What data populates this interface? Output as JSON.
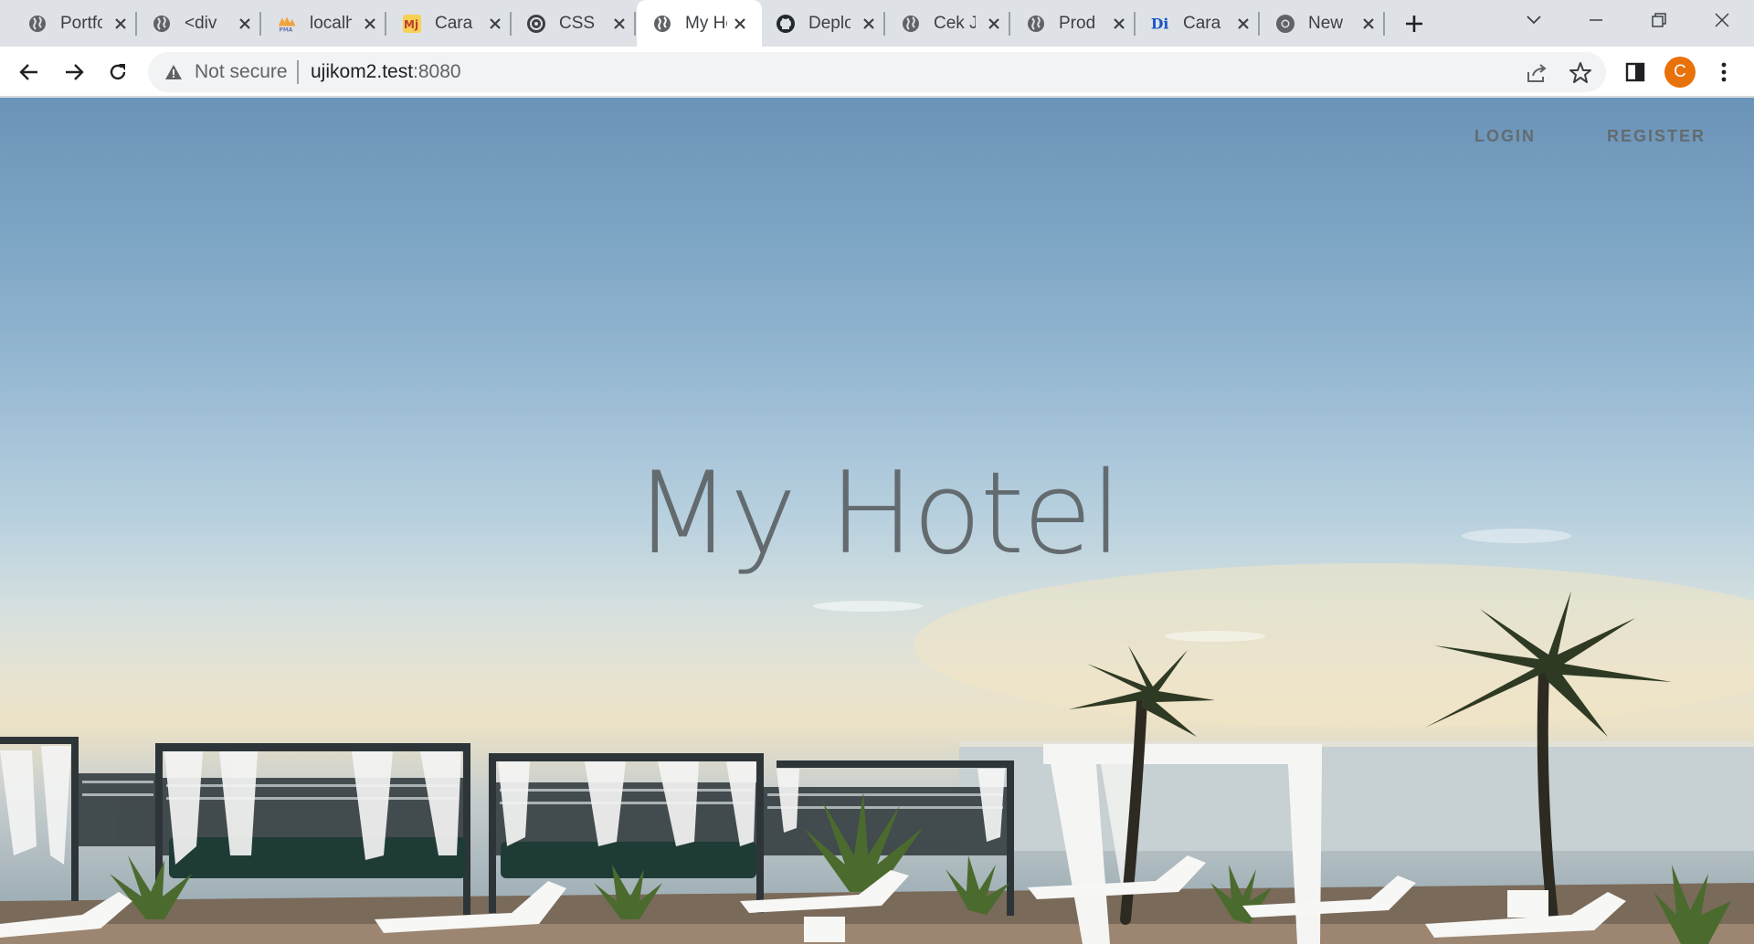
{
  "browser": {
    "tabs": [
      {
        "title": "Portfolio",
        "icon": "globe-icon",
        "active": false
      },
      {
        "title": "<div",
        "icon": "globe-icon",
        "active": false
      },
      {
        "title": "localhost",
        "icon": "phpmyadmin-icon",
        "active": false
      },
      {
        "title": "Cara",
        "icon": "mj-icon",
        "active": false
      },
      {
        "title": "CSS",
        "icon": "css-icon",
        "active": false
      },
      {
        "title": "My Hotel",
        "icon": "globe-icon",
        "active": true
      },
      {
        "title": "Deploy",
        "icon": "github-icon",
        "active": false
      },
      {
        "title": "Cek J",
        "icon": "globe-icon",
        "active": false
      },
      {
        "title": "Prod",
        "icon": "globe-icon",
        "active": false
      },
      {
        "title": "Cara",
        "icon": "di-icon",
        "active": false
      },
      {
        "title": "New",
        "icon": "chrome-icon",
        "active": false
      }
    ],
    "security_label": "Not secure",
    "url_host": "ujikom2.test",
    "url_port": ":8080",
    "avatar_letter": "C"
  },
  "page": {
    "nav": {
      "login": "LOGIN",
      "register": "REGISTER"
    },
    "title": "My Hotel"
  },
  "colors": {
    "accent_avatar": "#e8710a",
    "title_text": "#636b6f",
    "tabstrip": "#dee1e6"
  }
}
